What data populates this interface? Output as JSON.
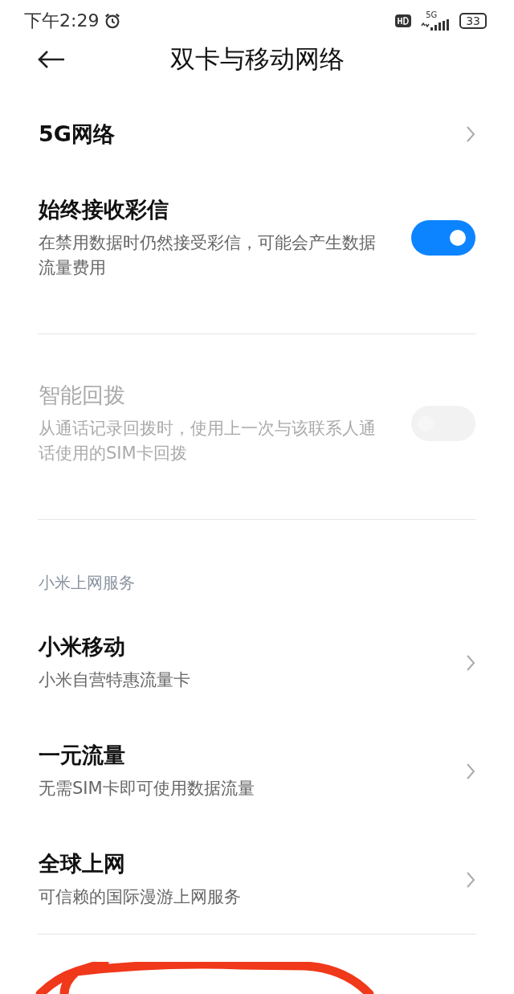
{
  "status_bar": {
    "time": "下午2:29",
    "network": "5G",
    "battery": "33"
  },
  "header": {
    "title": "双卡与移动网络"
  },
  "items": [
    {
      "kind": "nav",
      "title": "5G网络"
    },
    {
      "kind": "toggle",
      "title": "始终接收彩信",
      "subtitle": "在禁用数据时仍然接受彩信，可能会产生数据流量费用",
      "on": true,
      "disabled": false
    },
    {
      "kind": "divider"
    },
    {
      "kind": "toggle",
      "title": "智能回拨",
      "subtitle": "从通话记录回拨时，使用上一次与该联系人通话使用的SIM卡回拨",
      "on": false,
      "disabled": true
    },
    {
      "kind": "divider"
    },
    {
      "kind": "section",
      "title": "小米上网服务"
    },
    {
      "kind": "nav",
      "title": "小米移动",
      "subtitle": "小米自营特惠流量卡"
    },
    {
      "kind": "nav",
      "title": "一元流量",
      "subtitle": "无需SIM卡即可使用数据流量"
    },
    {
      "kind": "nav",
      "title": "全球上网",
      "subtitle": "可信赖的国际漫游上网服务"
    },
    {
      "kind": "divider"
    }
  ]
}
